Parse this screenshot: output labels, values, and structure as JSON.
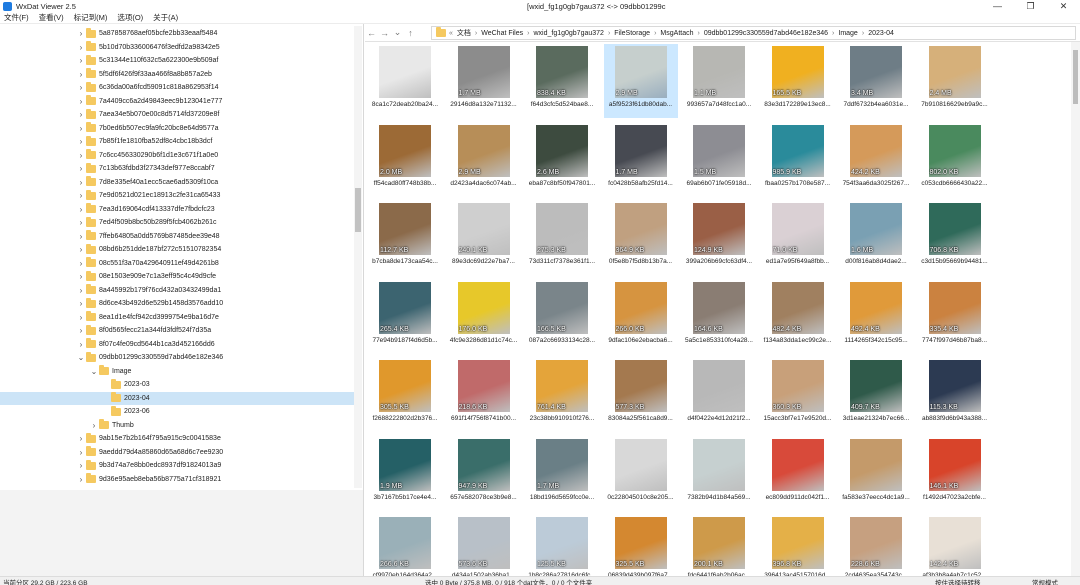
{
  "window": {
    "app_title": "WxDat Viewer 2.5",
    "path_title": "[wxid_fg1g0gb7gau372 <-> 09dbb01299c"
  },
  "menu": [
    "文件(F)",
    "查看(V)",
    "标记到(M)",
    "选项(O)",
    "关于(A)"
  ],
  "tree": {
    "items": [
      "5a87858768aef05bcfe2bb33eaaf5484",
      "5b10d70b336006476f3edfd2a98342e5",
      "5c31344e110f632c5a622300e9b509af",
      "5f5df6f426f9f33aa466f8a8b857a2eb",
      "6c36da00a6fcd59091c818a862953f14",
      "7a4409cc6a2d49843eec9b123041e777",
      "7aea34e5b070e00c8d5714fd37209e8f",
      "7b0ed6b507ec9fa9fc20bc8e64d9577a",
      "7b85f1fe1810fba52df8c4cbc18b3dcf",
      "7c6cc456330290b6f1d1e3c671f1a0e0",
      "7c13b63fdbd3f27343def977e8ccabf7",
      "7d8e335ef40a1ecc5cae6ad5309f10ca",
      "7e9d0521d021ec18913c2fe31ca65433",
      "7ea3d169064cdf413337dfe7fbdcfc23",
      "7ed4f509b8bc50b289f5fcb4062b261c",
      "7ffeb64805a0dd5769b87485dee39e48",
      "08bd6b251dde187bf272c51510782354",
      "08c551f3a70a429640911ef49d4261b8",
      "08e1503e909e7c1a3eff95c4c49d9cfe",
      "8a445992b179f76cd432a03432499da1",
      "8d6ce43b492d6e529b1458d3576add10",
      "8ea1d1e4fcf942cd3999754e9ba16d7e",
      "8f0d565fecc21a344fd3fdf524f7d35a",
      "8f07c4fe09cd5644b1ca3d452166dd6",
      "09dbb01299c330559d7abd46e182e346"
    ],
    "image_label": "Image",
    "sub": [
      "2023-03",
      "2023-04",
      "2023-06"
    ],
    "thumb_label": "Thumb",
    "after": [
      "9ab15e7b2b164f795a915c9c0041583e",
      "9aeddd79d4a85860d65a68d6c7ee9230",
      "9b3d74a7e8bb0edc8937df91824013a9",
      "9d36e95aeb8eba56b8775a71cf318921"
    ]
  },
  "breadcrumb": [
    "文档",
    "WeChat Files",
    "wxid_fg1g0gb7gau372",
    "FileStorage",
    "MsgAttach",
    "09dbb01299c330559d7abd46e182e346",
    "Image",
    "2023-04"
  ],
  "files": [
    {
      "name": "8ca1c72deab20ba24...",
      "size": ""
    },
    {
      "name": "29146d8a132e71132...",
      "size": "1.7 MB"
    },
    {
      "name": "f64d3cfc5d524bae8...",
      "size": "838.4 KB"
    },
    {
      "name": "a5f9523f61db80dab...",
      "size": "2.9 MB"
    },
    {
      "name": "993657a7d48fcc1a0...",
      "size": "1.1 MB"
    },
    {
      "name": "83e3d172289e13ec8...",
      "size": "165.5 KB"
    },
    {
      "name": "7ddf6732b4ea6031e...",
      "size": "3.4 MB"
    },
    {
      "name": "7b910816629eb9a9c...",
      "size": "2.4 MB"
    },
    {
      "name": "ff54cad80ff748b38b...",
      "size": "2.0 MB"
    },
    {
      "name": "d2423a4dac6c074ab...",
      "size": "2.9 MB"
    },
    {
      "name": "eba87c8bf50f947801...",
      "size": "2.6 MB"
    },
    {
      "name": "fc0428b58afb25fd14...",
      "size": "1.7 MB"
    },
    {
      "name": "69ab6b071fe05918d...",
      "size": "1.5 MB"
    },
    {
      "name": "fbaa0257b1708e587...",
      "size": "985.9 KB"
    },
    {
      "name": "754f3aa6da3025f267...",
      "size": "424.2 KB"
    },
    {
      "name": "c053cdb6666430a22...",
      "size": "802.0 KB"
    },
    {
      "name": "b7cba8de173caa54c...",
      "size": "112.7 KB"
    },
    {
      "name": "89e3dc69d22e7ba7...",
      "size": "240.1 KB"
    },
    {
      "name": "73d311cf7378e361f1...",
      "size": "275.3 KB"
    },
    {
      "name": "0f5e8b7f5d8b13b7a...",
      "size": "364.9 KB"
    },
    {
      "name": "399a206b69cfc63df4...",
      "size": "124.9 KB"
    },
    {
      "name": "ed1a7e95f649a8fbb...",
      "size": "71.0 KB"
    },
    {
      "name": "d00f816ab8d4dae2...",
      "size": "1.6 MB"
    },
    {
      "name": "c3d15b95669b94481...",
      "size": "706.8 KB"
    },
    {
      "name": "77e94b9187f4d6d5b...",
      "size": "265.4 KB"
    },
    {
      "name": "4fc9e3286d81d1c74c...",
      "size": "176.0 KB"
    },
    {
      "name": "087a2c66933134c28...",
      "size": "166.5 KB"
    },
    {
      "name": "9dfac106e2ebacba6...",
      "size": "266.0 KB"
    },
    {
      "name": "5a5c1e853310fc4a28...",
      "size": "164.6 KB"
    },
    {
      "name": "f134a83dda1ec99c2e...",
      "size": "482.4 KB"
    },
    {
      "name": "1114265f342c15c95...",
      "size": "492.4 KB"
    },
    {
      "name": "7747f997d46b87ba8...",
      "size": "335.4 KB"
    },
    {
      "name": "f2688222802d2b376...",
      "size": "305.5 KB"
    },
    {
      "name": "691f14f756f8741b00...",
      "size": "218.6 KB"
    },
    {
      "name": "23c38bb910910f276...",
      "size": "761.4 KB"
    },
    {
      "name": "83084a25f561ca8d9...",
      "size": "577.3 KB"
    },
    {
      "name": "d4f0422e4d12d21f2...",
      "size": ""
    },
    {
      "name": "15acc3bf7e17e9520d...",
      "size": "360.3 KB"
    },
    {
      "name": "3d1eae21324b7ec66...",
      "size": "409.7 KB"
    },
    {
      "name": "ab883f9d6b943a388...",
      "size": "115.3 KB"
    },
    {
      "name": "3b7167b5b17ce4e4...",
      "size": "1.9 MB"
    },
    {
      "name": "657e582078ce3b9e8...",
      "size": "947.9 KB"
    },
    {
      "name": "18bd196d5659fcc0e...",
      "size": "1.7 MB"
    },
    {
      "name": "0c228045010c8e205...",
      "size": ""
    },
    {
      "name": "7382b94d1b84a569...",
      "size": ""
    },
    {
      "name": "ec809dd911dc042f1...",
      "size": ""
    },
    {
      "name": "fa583e37eecc4dc1a9...",
      "size": ""
    },
    {
      "name": "f1492d47023a2cbfe...",
      "size": "146.1 KB"
    },
    {
      "name": "cf9970eb164d364a2...",
      "size": "266.6 KB"
    },
    {
      "name": "d434a1502ab36ba1...",
      "size": "573.6 KB"
    },
    {
      "name": "1b8c286a27816dc6fc...",
      "size": "125.5 KB"
    },
    {
      "name": "06839d439b097f6a7...",
      "size": "325.5 KB"
    },
    {
      "name": "fdc6441f6ab2b06ac...",
      "size": "200.1 KB"
    },
    {
      "name": "396413ac45157016d...",
      "size": "396.8 KB"
    },
    {
      "name": "2cd4635ea354743c...",
      "size": "228.6 KB"
    },
    {
      "name": "af3b3b8a4ab7c1c52...",
      "size": "142.4 KB"
    }
  ],
  "thumb_colors": [
    "#e8e8e8",
    "#8c8c8c",
    "#5a6b5e",
    "#c6cfcd",
    "#b7b7b3",
    "#f0b020",
    "#6e7d86",
    "#d6b07a",
    "#9c6a36",
    "#b78e58",
    "#3d4b3f",
    "#474a52",
    "#8d8d93",
    "#2a8b9b",
    "#d59a5a",
    "#4a8a5e",
    "#8b6a4a",
    "#cfcfcf",
    "#bcbcbc",
    "#c0a080",
    "#9a5f46",
    "#dad0d4",
    "#7aa0b3",
    "#2f6a5a",
    "#3c6470",
    "#e7c82a",
    "#7a858a",
    "#d69440",
    "#8a7d73",
    "#a08060",
    "#e09a3a",
    "#cb8240",
    "#e0982c",
    "#c06a6a",
    "#e4a43a",
    "#a4794f",
    "#b8b8b8",
    "#c8a07a",
    "#2f5a4a",
    "#2c3a52",
    "#256066",
    "#3a6e6a",
    "#6a7f86",
    "#d8d8d8",
    "#c6d0d0",
    "#d84a3a",
    "#c49a6a",
    "#d8442a",
    "#9ab0b8",
    "#b8c0c8",
    "#bccbd8",
    "#d48830",
    "#ce9a4a",
    "#e4b048",
    "#c6a080",
    "#e8e0d6"
  ],
  "status": {
    "disk": "当前分区 29.2 GB / 223.6 GB",
    "selection": "选中 0 Byte / 375.8 MB,  0 / 918 个dat文件，0 / 0 个文件夹",
    "hint": "按住选择待转移",
    "mode": "常规模式"
  }
}
